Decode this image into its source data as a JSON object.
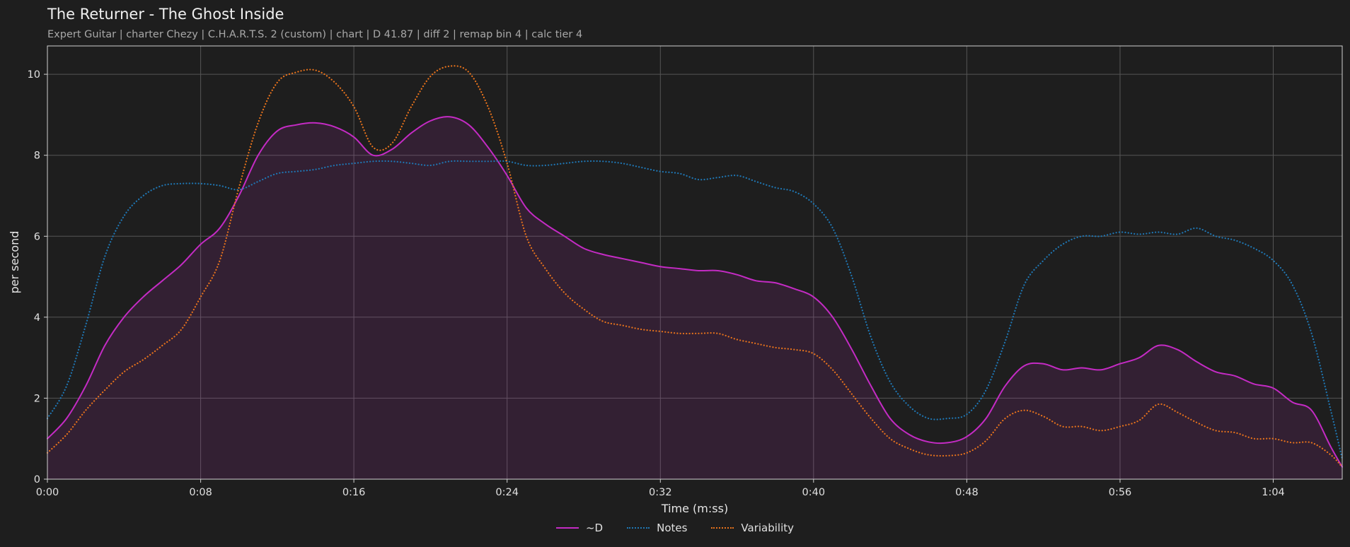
{
  "chart_data": {
    "type": "line",
    "title": "The Returner - The Ghost Inside",
    "subtitle": "Expert Guitar  |  charter Chezy  |  C.H.A.R.T.S. 2 (custom)  |  chart  |  D 41.87  |  diff 2  |  remap bin 4  |  calc tier 4",
    "xlabel": "Time (m:ss)",
    "ylabel": "per second",
    "xlim": [
      0,
      67.6
    ],
    "ylim": [
      0,
      10.7
    ],
    "grid": true,
    "legend_position": "bottom-center",
    "x_ticks": [
      {
        "value": 0,
        "label": "0:00"
      },
      {
        "value": 8,
        "label": "0:08"
      },
      {
        "value": 16,
        "label": "0:16"
      },
      {
        "value": 24,
        "label": "0:24"
      },
      {
        "value": 32,
        "label": "0:32"
      },
      {
        "value": 40,
        "label": "0:40"
      },
      {
        "value": 48,
        "label": "0:48"
      },
      {
        "value": 56,
        "label": "0:56"
      },
      {
        "value": 64,
        "label": "1:04"
      }
    ],
    "y_ticks": [
      {
        "value": 0,
        "label": "0"
      },
      {
        "value": 2,
        "label": "2"
      },
      {
        "value": 4,
        "label": "4"
      },
      {
        "value": 6,
        "label": "6"
      },
      {
        "value": 8,
        "label": "8"
      },
      {
        "value": 10,
        "label": "10"
      }
    ],
    "series": [
      {
        "name": "~D",
        "color": "#c42bc4",
        "style": "solid",
        "filled": true,
        "points": [
          [
            0,
            1.0
          ],
          [
            1,
            1.5
          ],
          [
            2,
            2.3
          ],
          [
            3,
            3.3
          ],
          [
            4,
            4.0
          ],
          [
            5,
            4.5
          ],
          [
            6,
            4.9
          ],
          [
            7,
            5.3
          ],
          [
            8,
            5.8
          ],
          [
            9,
            6.2
          ],
          [
            10,
            7.0
          ],
          [
            11,
            8.0
          ],
          [
            12,
            8.6
          ],
          [
            13,
            8.75
          ],
          [
            14,
            8.8
          ],
          [
            15,
            8.7
          ],
          [
            16,
            8.45
          ],
          [
            17,
            8.0
          ],
          [
            18,
            8.15
          ],
          [
            19,
            8.55
          ],
          [
            20,
            8.85
          ],
          [
            21,
            8.95
          ],
          [
            22,
            8.75
          ],
          [
            23,
            8.2
          ],
          [
            24,
            7.5
          ],
          [
            25,
            6.7
          ],
          [
            26,
            6.3
          ],
          [
            27,
            6.0
          ],
          [
            28,
            5.7
          ],
          [
            29,
            5.55
          ],
          [
            30,
            5.45
          ],
          [
            31,
            5.35
          ],
          [
            32,
            5.25
          ],
          [
            33,
            5.2
          ],
          [
            34,
            5.15
          ],
          [
            35,
            5.15
          ],
          [
            36,
            5.05
          ],
          [
            37,
            4.9
          ],
          [
            38,
            4.85
          ],
          [
            39,
            4.7
          ],
          [
            40,
            4.5
          ],
          [
            41,
            4.0
          ],
          [
            42,
            3.2
          ],
          [
            43,
            2.3
          ],
          [
            44,
            1.5
          ],
          [
            45,
            1.1
          ],
          [
            46,
            0.92
          ],
          [
            47,
            0.9
          ],
          [
            48,
            1.05
          ],
          [
            49,
            1.5
          ],
          [
            50,
            2.3
          ],
          [
            51,
            2.8
          ],
          [
            52,
            2.85
          ],
          [
            53,
            2.7
          ],
          [
            54,
            2.75
          ],
          [
            55,
            2.7
          ],
          [
            56,
            2.85
          ],
          [
            57,
            3.0
          ],
          [
            58,
            3.3
          ],
          [
            59,
            3.2
          ],
          [
            60,
            2.9
          ],
          [
            61,
            2.65
          ],
          [
            62,
            2.55
          ],
          [
            63,
            2.35
          ],
          [
            64,
            2.25
          ],
          [
            65,
            1.9
          ],
          [
            66,
            1.7
          ],
          [
            67,
            0.8
          ],
          [
            67.6,
            0.3
          ]
        ]
      },
      {
        "name": "Notes",
        "color": "#1f77b4",
        "style": "dotted",
        "filled": false,
        "points": [
          [
            0,
            1.5
          ],
          [
            1,
            2.3
          ],
          [
            2,
            3.8
          ],
          [
            3,
            5.5
          ],
          [
            4,
            6.5
          ],
          [
            5,
            7.0
          ],
          [
            6,
            7.25
          ],
          [
            7,
            7.3
          ],
          [
            8,
            7.3
          ],
          [
            9,
            7.25
          ],
          [
            10,
            7.15
          ],
          [
            11,
            7.35
          ],
          [
            12,
            7.55
          ],
          [
            13,
            7.6
          ],
          [
            14,
            7.65
          ],
          [
            15,
            7.75
          ],
          [
            16,
            7.8
          ],
          [
            17,
            7.85
          ],
          [
            18,
            7.85
          ],
          [
            19,
            7.8
          ],
          [
            20,
            7.75
          ],
          [
            21,
            7.85
          ],
          [
            22,
            7.85
          ],
          [
            23,
            7.85
          ],
          [
            24,
            7.85
          ],
          [
            25,
            7.75
          ],
          [
            26,
            7.75
          ],
          [
            27,
            7.8
          ],
          [
            28,
            7.85
          ],
          [
            29,
            7.85
          ],
          [
            30,
            7.8
          ],
          [
            31,
            7.7
          ],
          [
            32,
            7.6
          ],
          [
            33,
            7.55
          ],
          [
            34,
            7.4
          ],
          [
            35,
            7.45
          ],
          [
            36,
            7.5
          ],
          [
            37,
            7.35
          ],
          [
            38,
            7.2
          ],
          [
            39,
            7.1
          ],
          [
            40,
            6.8
          ],
          [
            41,
            6.2
          ],
          [
            42,
            5.0
          ],
          [
            43,
            3.5
          ],
          [
            44,
            2.4
          ],
          [
            45,
            1.8
          ],
          [
            46,
            1.5
          ],
          [
            47,
            1.5
          ],
          [
            48,
            1.6
          ],
          [
            49,
            2.2
          ],
          [
            50,
            3.4
          ],
          [
            51,
            4.8
          ],
          [
            52,
            5.4
          ],
          [
            53,
            5.8
          ],
          [
            54,
            6.0
          ],
          [
            55,
            6.0
          ],
          [
            56,
            6.1
          ],
          [
            57,
            6.05
          ],
          [
            58,
            6.1
          ],
          [
            59,
            6.05
          ],
          [
            60,
            6.2
          ],
          [
            61,
            6.0
          ],
          [
            62,
            5.9
          ],
          [
            63,
            5.7
          ],
          [
            64,
            5.4
          ],
          [
            65,
            4.8
          ],
          [
            66,
            3.6
          ],
          [
            67,
            1.7
          ],
          [
            67.6,
            0.5
          ]
        ]
      },
      {
        "name": "Variability",
        "color": "#e8731c",
        "style": "dotted",
        "filled": false,
        "points": [
          [
            0,
            0.65
          ],
          [
            1,
            1.1
          ],
          [
            2,
            1.7
          ],
          [
            3,
            2.2
          ],
          [
            4,
            2.65
          ],
          [
            5,
            2.95
          ],
          [
            6,
            3.3
          ],
          [
            7,
            3.7
          ],
          [
            8,
            4.5
          ],
          [
            9,
            5.4
          ],
          [
            10,
            7.2
          ],
          [
            11,
            8.8
          ],
          [
            12,
            9.8
          ],
          [
            13,
            10.05
          ],
          [
            14,
            10.1
          ],
          [
            15,
            9.8
          ],
          [
            16,
            9.2
          ],
          [
            17,
            8.2
          ],
          [
            18,
            8.3
          ],
          [
            19,
            9.2
          ],
          [
            20,
            9.95
          ],
          [
            21,
            10.2
          ],
          [
            22,
            10.05
          ],
          [
            23,
            9.2
          ],
          [
            24,
            7.8
          ],
          [
            25,
            6.0
          ],
          [
            26,
            5.2
          ],
          [
            27,
            4.6
          ],
          [
            28,
            4.2
          ],
          [
            29,
            3.9
          ],
          [
            30,
            3.8
          ],
          [
            31,
            3.7
          ],
          [
            32,
            3.65
          ],
          [
            33,
            3.6
          ],
          [
            34,
            3.6
          ],
          [
            35,
            3.6
          ],
          [
            36,
            3.45
          ],
          [
            37,
            3.35
          ],
          [
            38,
            3.25
          ],
          [
            39,
            3.2
          ],
          [
            40,
            3.1
          ],
          [
            41,
            2.7
          ],
          [
            42,
            2.1
          ],
          [
            43,
            1.5
          ],
          [
            44,
            1.0
          ],
          [
            45,
            0.75
          ],
          [
            46,
            0.6
          ],
          [
            47,
            0.58
          ],
          [
            48,
            0.65
          ],
          [
            49,
            0.95
          ],
          [
            50,
            1.5
          ],
          [
            51,
            1.7
          ],
          [
            52,
            1.55
          ],
          [
            53,
            1.3
          ],
          [
            54,
            1.3
          ],
          [
            55,
            1.2
          ],
          [
            56,
            1.3
          ],
          [
            57,
            1.45
          ],
          [
            58,
            1.85
          ],
          [
            59,
            1.65
          ],
          [
            60,
            1.4
          ],
          [
            61,
            1.2
          ],
          [
            62,
            1.15
          ],
          [
            63,
            1.0
          ],
          [
            64,
            1.0
          ],
          [
            65,
            0.9
          ],
          [
            66,
            0.9
          ],
          [
            67,
            0.6
          ],
          [
            67.6,
            0.3
          ]
        ]
      }
    ]
  }
}
